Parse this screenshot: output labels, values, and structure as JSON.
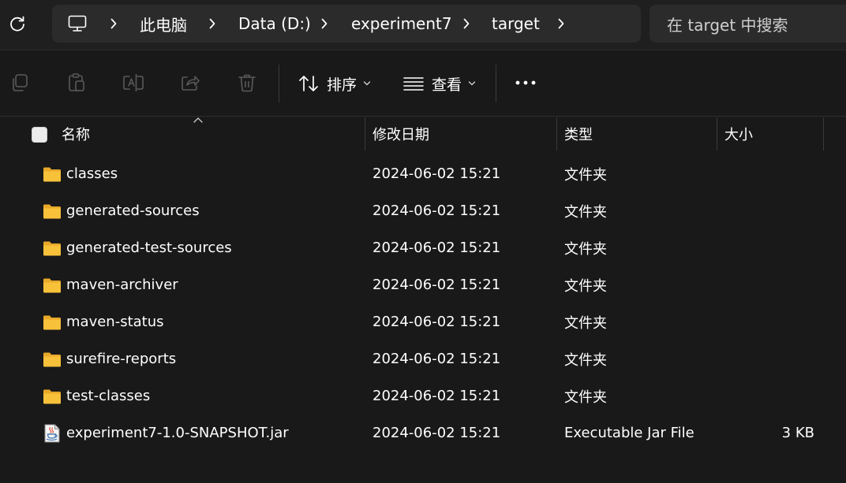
{
  "window": {
    "refresh_icon": "refresh-icon",
    "breadcrumb": [
      "此电脑",
      "Data (D:)",
      "experiment7",
      "target"
    ],
    "search_placeholder": "在 target 中搜索"
  },
  "toolbar": {
    "icons": [
      "copy-icon",
      "paste-icon",
      "rename-icon",
      "share-icon",
      "delete-icon"
    ],
    "sort_label": "排序",
    "view_label": "查看",
    "more_icon": "more-icon"
  },
  "columns": {
    "name": "名称",
    "date": "修改日期",
    "type": "类型",
    "size": "大小",
    "sorted_by": "name",
    "sort_direction": "ascending"
  },
  "files": [
    {
      "name": "classes",
      "date": "2024-06-02 15:21",
      "type": "文件夹",
      "size": "",
      "icon": "folder-icon"
    },
    {
      "name": "generated-sources",
      "date": "2024-06-02 15:21",
      "type": "文件夹",
      "size": "",
      "icon": "folder-icon"
    },
    {
      "name": "generated-test-sources",
      "date": "2024-06-02 15:21",
      "type": "文件夹",
      "size": "",
      "icon": "folder-icon"
    },
    {
      "name": "maven-archiver",
      "date": "2024-06-02 15:21",
      "type": "文件夹",
      "size": "",
      "icon": "folder-icon"
    },
    {
      "name": "maven-status",
      "date": "2024-06-02 15:21",
      "type": "文件夹",
      "size": "",
      "icon": "folder-icon"
    },
    {
      "name": "surefire-reports",
      "date": "2024-06-02 15:21",
      "type": "文件夹",
      "size": "",
      "icon": "folder-icon"
    },
    {
      "name": "test-classes",
      "date": "2024-06-02 15:21",
      "type": "文件夹",
      "size": "",
      "icon": "folder-icon"
    },
    {
      "name": "experiment7-1.0-SNAPSHOT.jar",
      "date": "2024-06-02 15:21",
      "type": "Executable Jar File",
      "size": "3 KB",
      "icon": "java-jar-icon"
    }
  ],
  "colors": {
    "background": "#191919",
    "bar": "#1f1f1f",
    "field": "#2b2b2b",
    "folder": "#f8c13a",
    "disabled_icon": "#5a5a5a"
  }
}
